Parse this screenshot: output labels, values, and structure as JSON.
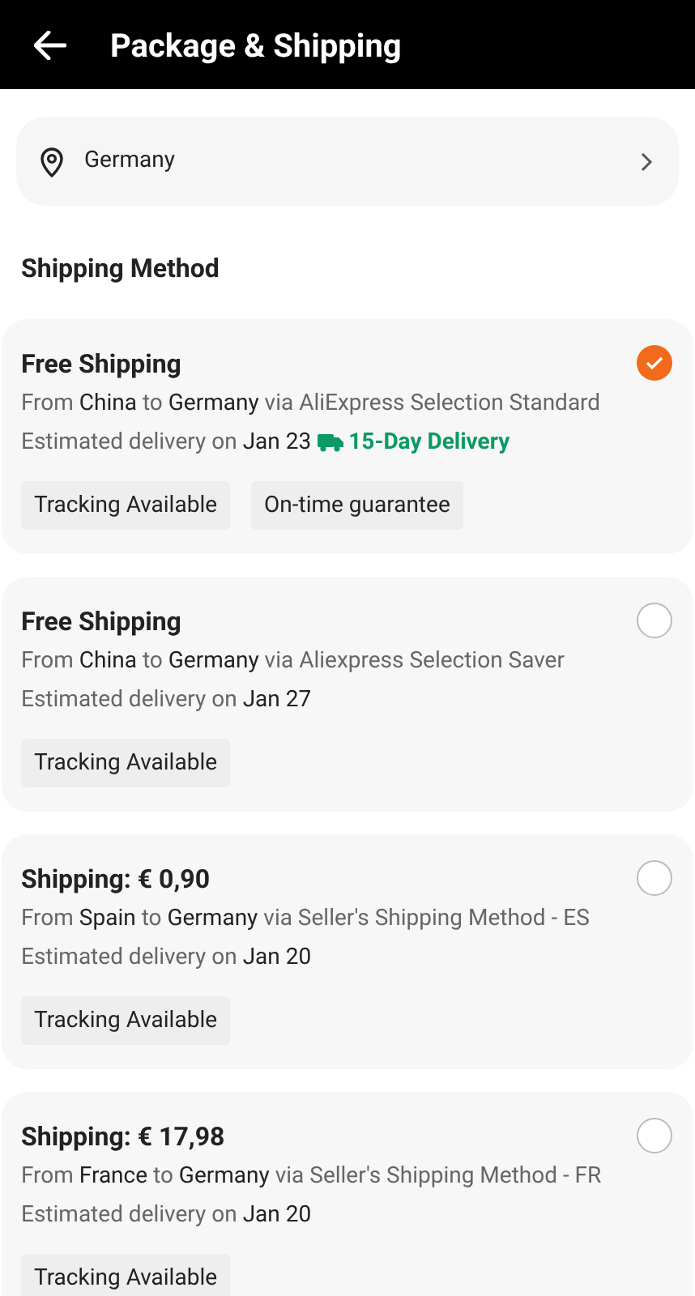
{
  "header": {
    "title": "Package & Shipping"
  },
  "location": {
    "country": "Germany"
  },
  "section_title": "Shipping Method",
  "methods": [
    {
      "title": "Free Shipping",
      "selected": true,
      "route": [
        {
          "text": "From",
          "emphasis": false
        },
        {
          "text": "China",
          "emphasis": true
        },
        {
          "text": "to",
          "emphasis": false
        },
        {
          "text": "Germany",
          "emphasis": true
        },
        {
          "text": "via AliExpress Selection Standard",
          "emphasis": false
        }
      ],
      "delivery": [
        {
          "text": "Estimated delivery on",
          "emphasis": false
        },
        {
          "text": "Jan 23",
          "emphasis": true
        }
      ],
      "badge": "15-Day Delivery",
      "tags": [
        "Tracking Available",
        "On-time guarantee"
      ]
    },
    {
      "title": "Free Shipping",
      "selected": false,
      "route": [
        {
          "text": "From",
          "emphasis": false
        },
        {
          "text": "China",
          "emphasis": true
        },
        {
          "text": "to",
          "emphasis": false
        },
        {
          "text": "Germany",
          "emphasis": true
        },
        {
          "text": "via Aliexpress Selection Saver",
          "emphasis": false
        }
      ],
      "delivery": [
        {
          "text": "Estimated delivery on",
          "emphasis": false
        },
        {
          "text": "Jan 27",
          "emphasis": true
        }
      ],
      "tags": [
        "Tracking Available"
      ]
    },
    {
      "title": "Shipping: € 0,90",
      "selected": false,
      "route": [
        {
          "text": "From",
          "emphasis": false
        },
        {
          "text": "Spain",
          "emphasis": true
        },
        {
          "text": "to",
          "emphasis": false
        },
        {
          "text": "Germany",
          "emphasis": true
        },
        {
          "text": "via Seller's Shipping Method - ES",
          "emphasis": false
        }
      ],
      "delivery": [
        {
          "text": "Estimated delivery on",
          "emphasis": false
        },
        {
          "text": "Jan 20",
          "emphasis": true
        }
      ],
      "tags": [
        "Tracking Available"
      ]
    },
    {
      "title": "Shipping: € 17,98",
      "selected": false,
      "route": [
        {
          "text": "From",
          "emphasis": false
        },
        {
          "text": "France",
          "emphasis": true
        },
        {
          "text": "to",
          "emphasis": false
        },
        {
          "text": "Germany",
          "emphasis": true
        },
        {
          "text": "via Seller's Shipping Method - FR",
          "emphasis": false
        }
      ],
      "delivery": [
        {
          "text": "Estimated delivery on",
          "emphasis": false
        },
        {
          "text": "Jan 20",
          "emphasis": true
        }
      ],
      "tags": [
        "Tracking Available"
      ]
    }
  ]
}
